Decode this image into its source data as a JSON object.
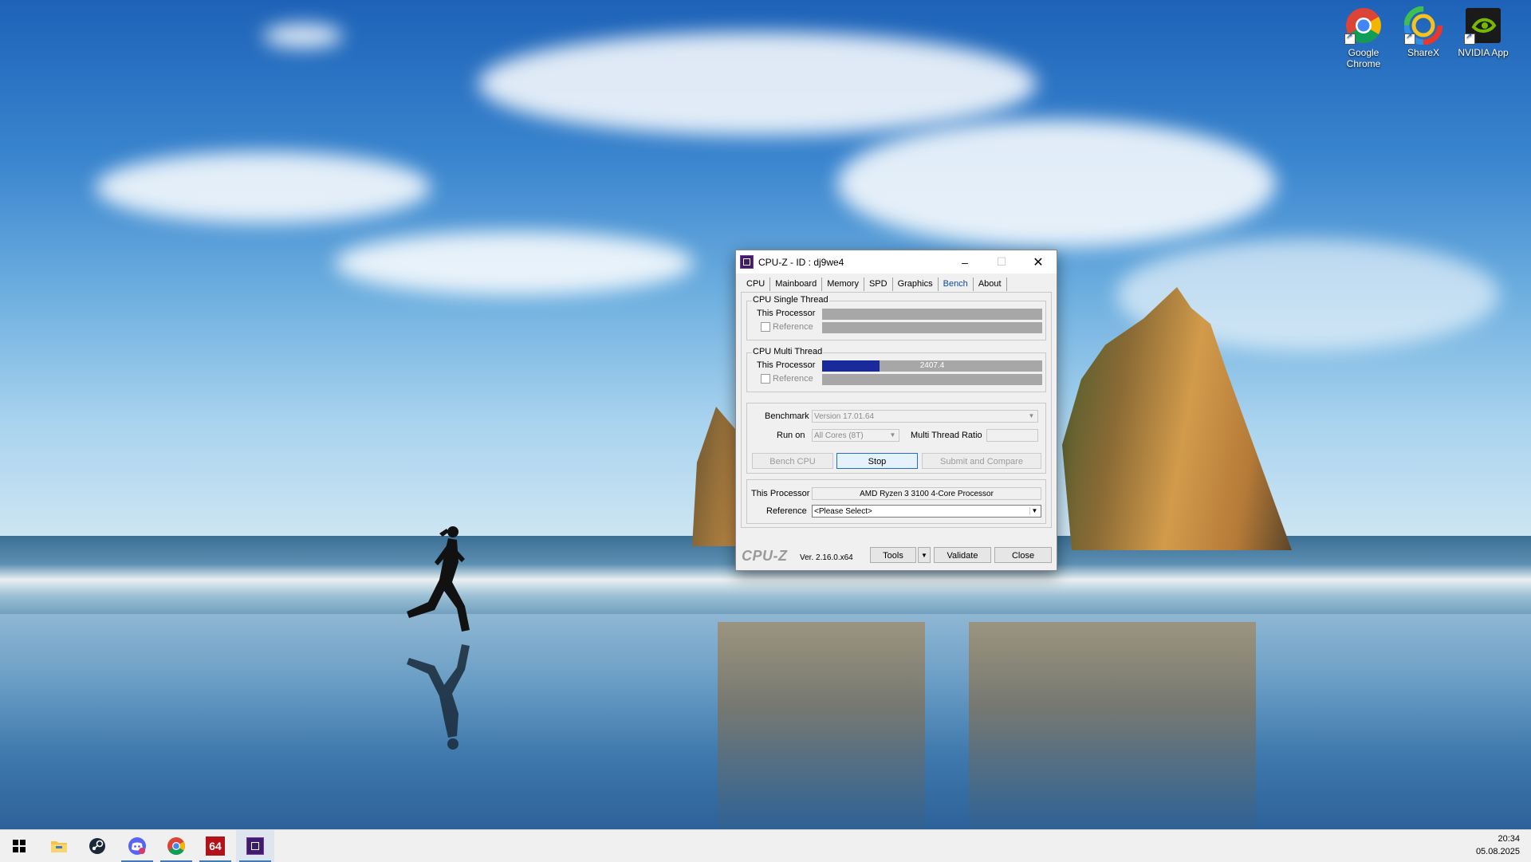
{
  "desktop": {
    "icons": [
      {
        "label": "Google Chrome",
        "icon": "chrome-icon"
      },
      {
        "label": "ShareX",
        "icon": "sharex-icon"
      },
      {
        "label": "NVIDIA App",
        "icon": "nvidia-icon"
      }
    ]
  },
  "window": {
    "title": "CPU-Z - ID : dj9we4",
    "controls": {
      "minimize": "–",
      "maximize": "☐",
      "close": "✕"
    },
    "tabs": [
      "CPU",
      "Mainboard",
      "Memory",
      "SPD",
      "Graphics",
      "Bench",
      "About"
    ],
    "active_tab": "Bench",
    "single_thread": {
      "legend": "CPU Single Thread",
      "this_processor_label": "This Processor",
      "reference_label": "Reference",
      "reference_checked": false
    },
    "multi_thread": {
      "legend": "CPU Multi Thread",
      "this_processor_label": "This Processor",
      "this_processor_value": "2407.4",
      "this_processor_fill": 0.26,
      "reference_label": "Reference",
      "reference_checked": false
    },
    "benchmark": {
      "label": "Benchmark",
      "value": "Version 17.01.64",
      "run_on_label": "Run on",
      "run_on_value": "All Cores (8T)",
      "ratio_label": "Multi Thread Ratio",
      "ratio_value": ""
    },
    "buttons": {
      "bench_cpu": "Bench CPU",
      "stop": "Stop",
      "submit": "Submit and Compare"
    },
    "processor": {
      "this_label": "This Processor",
      "this_value": "AMD Ryzen 3 3100 4-Core Processor",
      "ref_label": "Reference",
      "ref_value": "<Please Select>"
    },
    "footer": {
      "logo": "CPU-Z",
      "version": "Ver. 2.16.0.x64",
      "tools": "Tools",
      "validate": "Validate",
      "close": "Close"
    }
  },
  "taskbar": {
    "items": [
      {
        "icon": "windows-start-icon"
      },
      {
        "icon": "file-explorer-icon"
      },
      {
        "icon": "steam-icon"
      },
      {
        "icon": "discord-icon"
      },
      {
        "icon": "chrome-icon"
      },
      {
        "icon": "aida64-icon",
        "label": "64"
      },
      {
        "icon": "cpuz-icon"
      }
    ],
    "time": "20:34",
    "date": "05.08.2025"
  },
  "colors": {
    "bench_bar_fill": "#1a2a9c",
    "bench_bar_bg": "#a7a7a7",
    "active_tab": "#0b4a9a",
    "focus_border": "#1f6fd0"
  }
}
